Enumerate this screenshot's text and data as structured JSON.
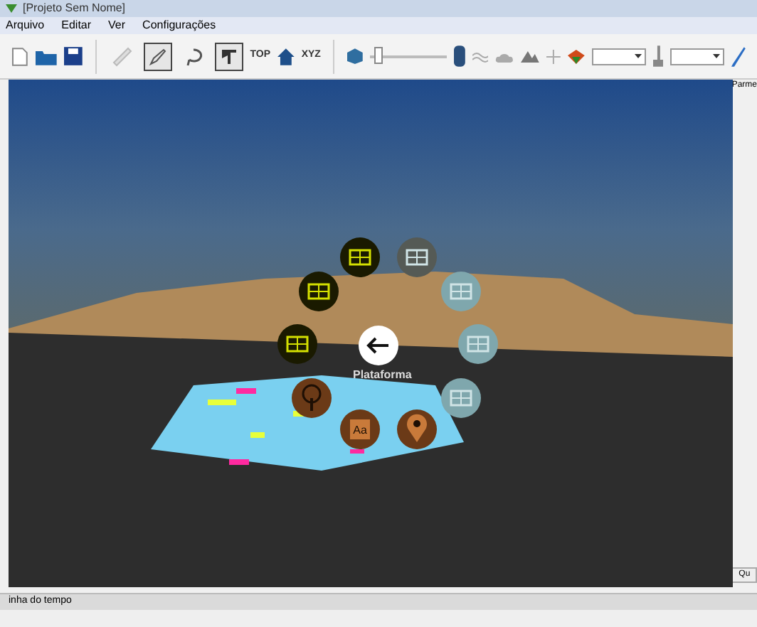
{
  "window": {
    "title": "[Projeto Sem Nome]"
  },
  "menu": [
    "Arquivo",
    "Editar",
    "Ver",
    "Configurações"
  ],
  "toolbar": {
    "tools": [
      {
        "kind": "ruler",
        "selected": false
      },
      {
        "kind": "pencil",
        "selected": true
      },
      {
        "kind": "lasso",
        "selected": false
      },
      {
        "kind": "plane",
        "selected": true
      }
    ],
    "views": [
      "TOP",
      "XYZ"
    ],
    "slider": {
      "level": 0.05
    }
  },
  "radial_menu": {
    "label": "Plataforma",
    "items": [
      {
        "kind": "thumbnail",
        "color": "#1a1a00"
      },
      {
        "kind": "thumbnail",
        "color": "#555a55"
      },
      {
        "kind": "thumbnail",
        "color": "#1a1a00"
      },
      {
        "kind": "thumbnail",
        "color": "#7fa7ad"
      },
      {
        "kind": "thumbnail",
        "color": "#1a1a00"
      },
      {
        "kind": "thumbnail",
        "color": "#7fa7ad"
      },
      {
        "kind": "tree",
        "color": "#6b3a17"
      },
      {
        "kind": "thumbnail",
        "color": "#7fa7ad"
      },
      {
        "kind": "text",
        "color": "#6b3a17",
        "glyph": "Aa"
      },
      {
        "kind": "pin",
        "color": "#6b3a17"
      }
    ]
  },
  "side_panel": {
    "title": "Parme",
    "button": "Qu"
  },
  "timeline": {
    "title": "inha do tempo"
  }
}
